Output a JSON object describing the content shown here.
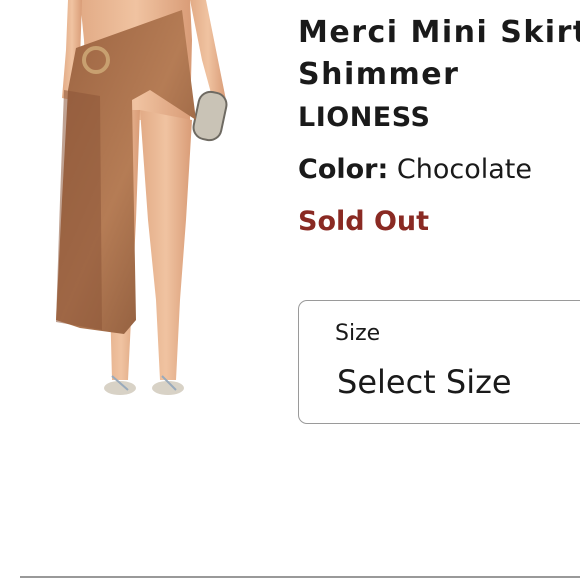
{
  "product": {
    "title": "Merci Mini Skirt\nShimmer",
    "brand": "LIONESS",
    "color_label": "Color:",
    "color_value": "Chocolate",
    "status": "Sold Out",
    "status_color": "#8a2a23"
  },
  "size_selector": {
    "label": "Size",
    "value": "Select Size"
  }
}
